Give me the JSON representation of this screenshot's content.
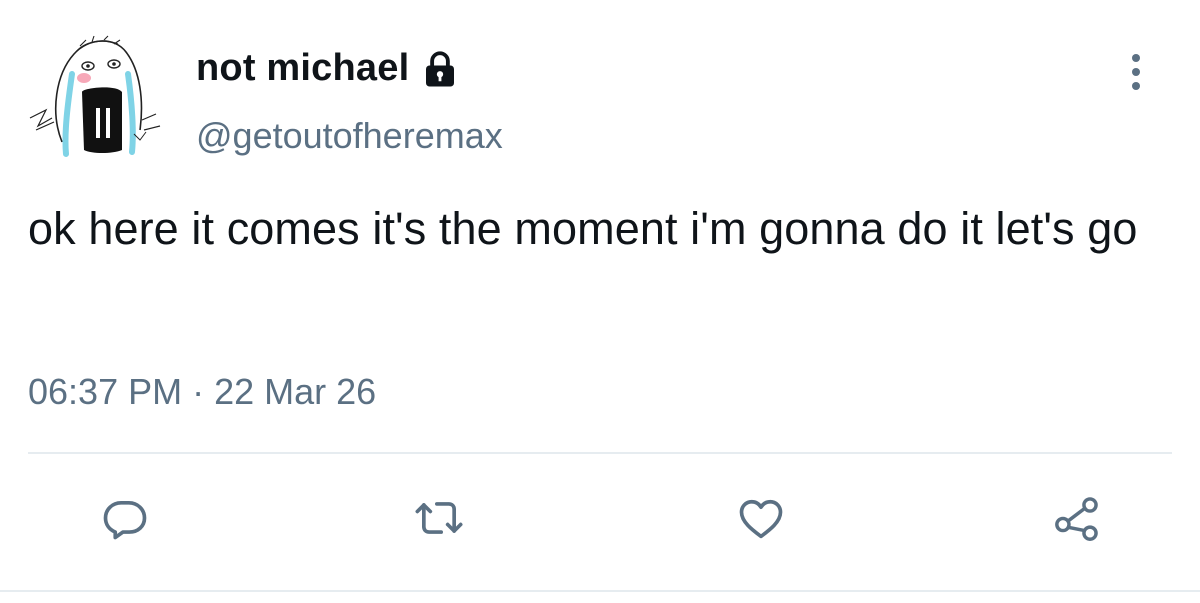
{
  "user": {
    "display_name": "not michael",
    "handle": "@getoutofheremax",
    "protected_icon": "lock-icon",
    "avatar_icon": "crying-face-drawing-avatar"
  },
  "tweet": {
    "text": "ok here it comes it's the moment i'm gonna do it let's go",
    "time": "06:37 PM",
    "separator": "·",
    "date": "22 Mar 26"
  },
  "actions": [
    {
      "icon": "reply-icon"
    },
    {
      "icon": "retweet-icon"
    },
    {
      "icon": "like-icon"
    },
    {
      "icon": "share-icon"
    }
  ],
  "menu": {
    "icon": "more-vertical-icon"
  },
  "colors": {
    "text_primary": "#0f1419",
    "text_secondary": "#5b7083",
    "icon": "#5b7083",
    "divider": "#e6ecf0",
    "avatar_tears": "#7fd3e6",
    "avatar_cheek": "#f7a8b8"
  }
}
